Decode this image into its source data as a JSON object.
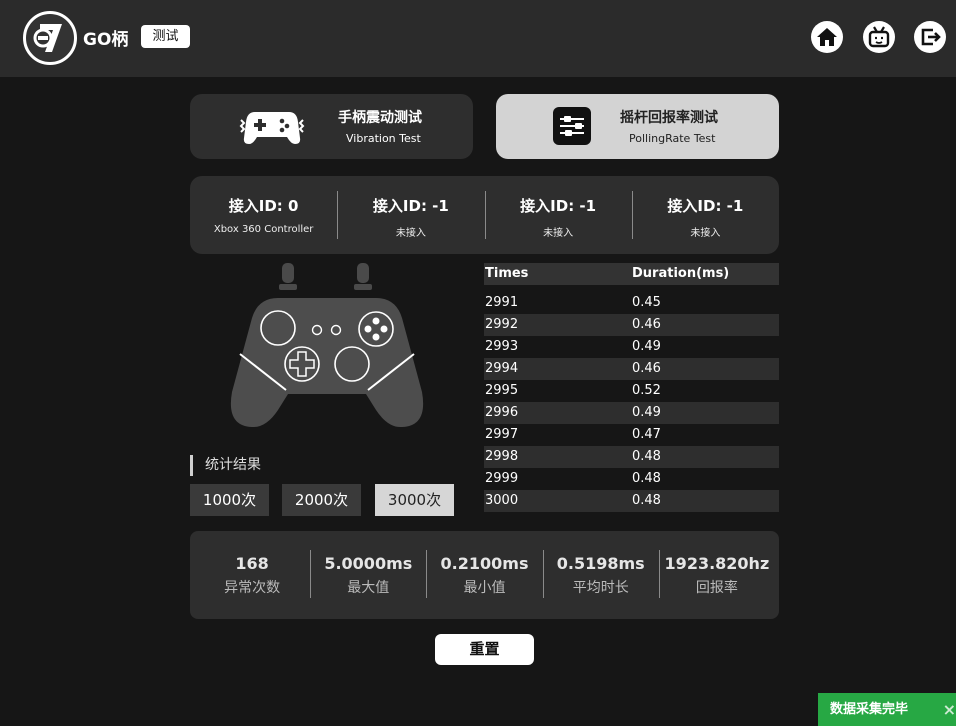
{
  "header": {
    "app_name": "GO柄",
    "badge": "测试",
    "icons": [
      "home-icon",
      "tv-robot-icon",
      "logout-icon"
    ]
  },
  "modes": [
    {
      "title": "手柄震动测试",
      "subtitle": "Vibration Test",
      "active": false
    },
    {
      "title": "摇杆回报率测试",
      "subtitle": "PollingRate Test",
      "active": true
    }
  ],
  "slots": [
    {
      "id": "接入ID: 0",
      "name": "Xbox 360 Controller"
    },
    {
      "id": "接入ID: -1",
      "name": "未接入"
    },
    {
      "id": "接入ID: -1",
      "name": "未接入"
    },
    {
      "id": "接入ID: -1",
      "name": "未接入"
    }
  ],
  "stats": {
    "title": "统计结果",
    "options": [
      {
        "label": "1000次",
        "selected": false
      },
      {
        "label": "2000次",
        "selected": false
      },
      {
        "label": "3000次",
        "selected": true
      }
    ]
  },
  "table": {
    "headers": [
      "Times",
      "Duration(ms)"
    ],
    "rows": [
      [
        "2991",
        "0.45"
      ],
      [
        "2992",
        "0.46"
      ],
      [
        "2993",
        "0.49"
      ],
      [
        "2994",
        "0.46"
      ],
      [
        "2995",
        "0.52"
      ],
      [
        "2996",
        "0.49"
      ],
      [
        "2997",
        "0.47"
      ],
      [
        "2998",
        "0.48"
      ],
      [
        "2999",
        "0.48"
      ],
      [
        "3000",
        "0.48"
      ]
    ]
  },
  "summary": [
    {
      "value": "168",
      "label": "异常次数"
    },
    {
      "value": "5.0000ms",
      "label": "最大值"
    },
    {
      "value": "0.2100ms",
      "label": "最小值"
    },
    {
      "value": "0.5198ms",
      "label": "平均时长"
    },
    {
      "value": "1923.820hz",
      "label": "回报率"
    }
  ],
  "reset_label": "重置",
  "toast": {
    "text": "数据采集完毕",
    "close": "×"
  },
  "colors": {
    "toast": "#27a844",
    "active_tab": "#d3d3d3",
    "panel": "#2e2e2e"
  }
}
